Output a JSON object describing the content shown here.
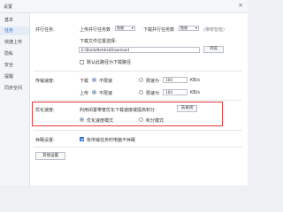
{
  "window": {
    "title": "设置",
    "close_glyph": "×"
  },
  "sidebar": {
    "items": [
      {
        "label": "基本"
      },
      {
        "label": "任务"
      },
      {
        "label": "快捷上传"
      },
      {
        "label": "隐私"
      },
      {
        "label": "安全"
      },
      {
        "label": "提醒"
      },
      {
        "label": "同步空间"
      }
    ]
  },
  "tasks": {
    "section_label": "并行任务:",
    "upload_label": "上传并行任务数",
    "upload_value": "智能",
    "download_label": "下载并行任务数",
    "download_value": "智能",
    "recommend_hint": "(推荐智能)",
    "location_label": "下载文件位置选择:",
    "location_value": "E:\\BaiduNetdiskDownload",
    "browse_label": "浏览",
    "default_checkbox_label": "默认此路径为下载路径",
    "default_checked": false
  },
  "speed": {
    "section_label": "传输速度:",
    "download_label": "下载",
    "upload_label": "上传",
    "unlimited_label": "不限速",
    "limit_label": "限速为",
    "download_limit_value": "100",
    "upload_limit_value": "100",
    "unit": "KB/s"
  },
  "optimize": {
    "section_label": "优化速度:",
    "description": "利用闲置带宽优化下载速度或提高积分",
    "button_label": "去关闭",
    "option1": "优化速度模式",
    "option2": "积分模式"
  },
  "sleep": {
    "section_label": "休眠设置:",
    "checkbox_label": "有传输任务时电脑不休眠",
    "checked": true
  },
  "other": {
    "button_label": "其他设置"
  },
  "colors": {
    "accent": "#2a6fd6",
    "highlight_border": "#e23b3b"
  }
}
